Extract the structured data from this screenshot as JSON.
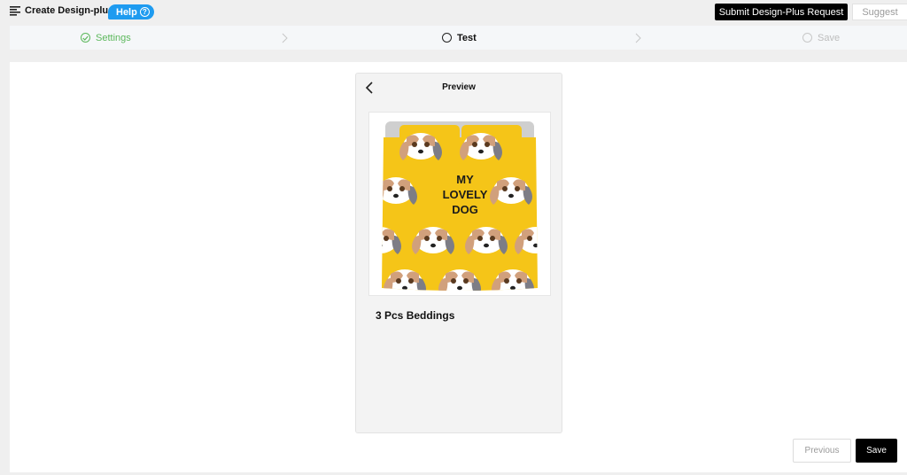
{
  "header": {
    "app_title": "Create Design-plus",
    "help_label": "Help",
    "submit_label": "Submit Design-Plus Request",
    "suggest_label": "Suggest"
  },
  "steps": [
    {
      "label": "Settings",
      "state": "completed"
    },
    {
      "label": "Test",
      "state": "current"
    },
    {
      "label": "Save",
      "state": "pending"
    }
  ],
  "preview": {
    "title": "Preview",
    "product_name": "3 Pcs Beddings",
    "image_text": [
      "MY",
      "LOVELY",
      "DOG"
    ]
  },
  "footer": {
    "previous_label": "Previous",
    "save_label": "Save"
  },
  "colors": {
    "accent_blue": "#1e9bf0",
    "success_green": "#5cb85c",
    "bedding_yellow": "#f5c518",
    "primary_black": "#000000"
  },
  "icons": [
    "menu-icon",
    "help-circle-icon",
    "check-circle-icon",
    "circle-icon",
    "chevron-right-icon",
    "back-arrow-icon"
  ]
}
